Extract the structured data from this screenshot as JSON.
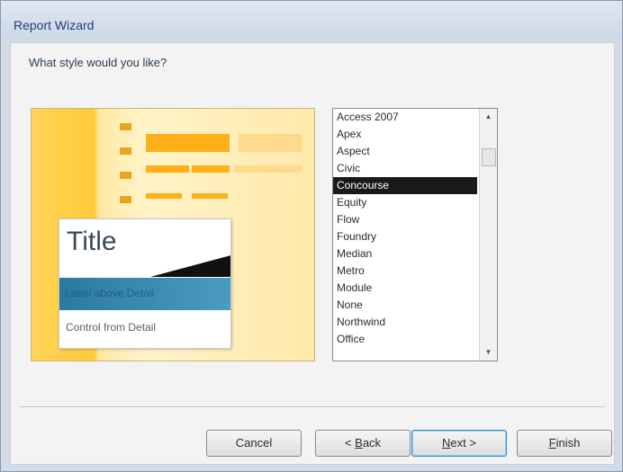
{
  "window": {
    "title": "Report Wizard"
  },
  "prompt": {
    "question": "What style would you like?"
  },
  "preview": {
    "title": "Title",
    "header_text": "Label above Detail",
    "detail_text": "Control from Detail"
  },
  "styles": {
    "items": [
      "Access 2007",
      "Apex",
      "Aspect",
      "Civic",
      "Concourse",
      "Equity",
      "Flow",
      "Foundry",
      "Median",
      "Metro",
      "Module",
      "None",
      "Northwind",
      "Office"
    ],
    "selected": "Concourse"
  },
  "buttons": {
    "cancel": {
      "label": "Cancel"
    },
    "back": {
      "prefix": "< ",
      "hotkey": "B",
      "rest": "ack"
    },
    "next": {
      "hotkey": "N",
      "rest": "ext >"
    },
    "finish": {
      "hotkey": "F",
      "rest": "inish"
    }
  }
}
